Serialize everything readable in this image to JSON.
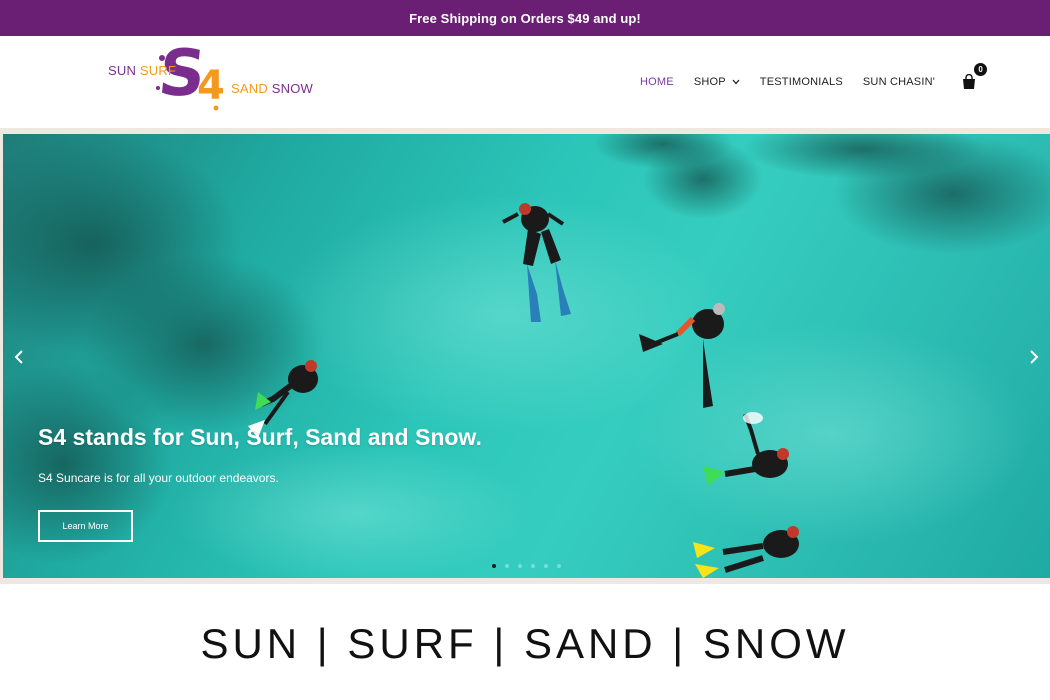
{
  "announcement": "Free Shipping on Orders $49 and up!",
  "logo": {
    "line1_word1": "SUN",
    "line1_word2": "SURF",
    "line2_word1": "SAND",
    "line2_word2": "SNOW",
    "mark_s": "S",
    "mark_4": "4",
    "purple": "#7b2d8e",
    "orange": "#f39a1e"
  },
  "nav": {
    "items": [
      {
        "label": "HOME",
        "active": true
      },
      {
        "label": "SHOP",
        "has_dropdown": true
      },
      {
        "label": "TESTIMONIALS"
      },
      {
        "label": "SUN CHASIN'"
      }
    ],
    "cart_count": "0",
    "cart_icon": "shopping-bag-icon"
  },
  "hero": {
    "title": "S4 stands for Sun, Surf, Sand and Snow.",
    "subtitle": "S4 Suncare is for all your outdoor endeavors.",
    "button_label": "Learn More",
    "slide_count": 6,
    "active_slide": 1,
    "prev_icon": "chevron-left-icon",
    "next_icon": "chevron-right-icon"
  },
  "tagline": "SUN | SURF | SAND | SNOW",
  "colors": {
    "announce_bg": "#6a1f74",
    "nav_active": "#7b3aa6",
    "water": "#2cc6b9"
  }
}
